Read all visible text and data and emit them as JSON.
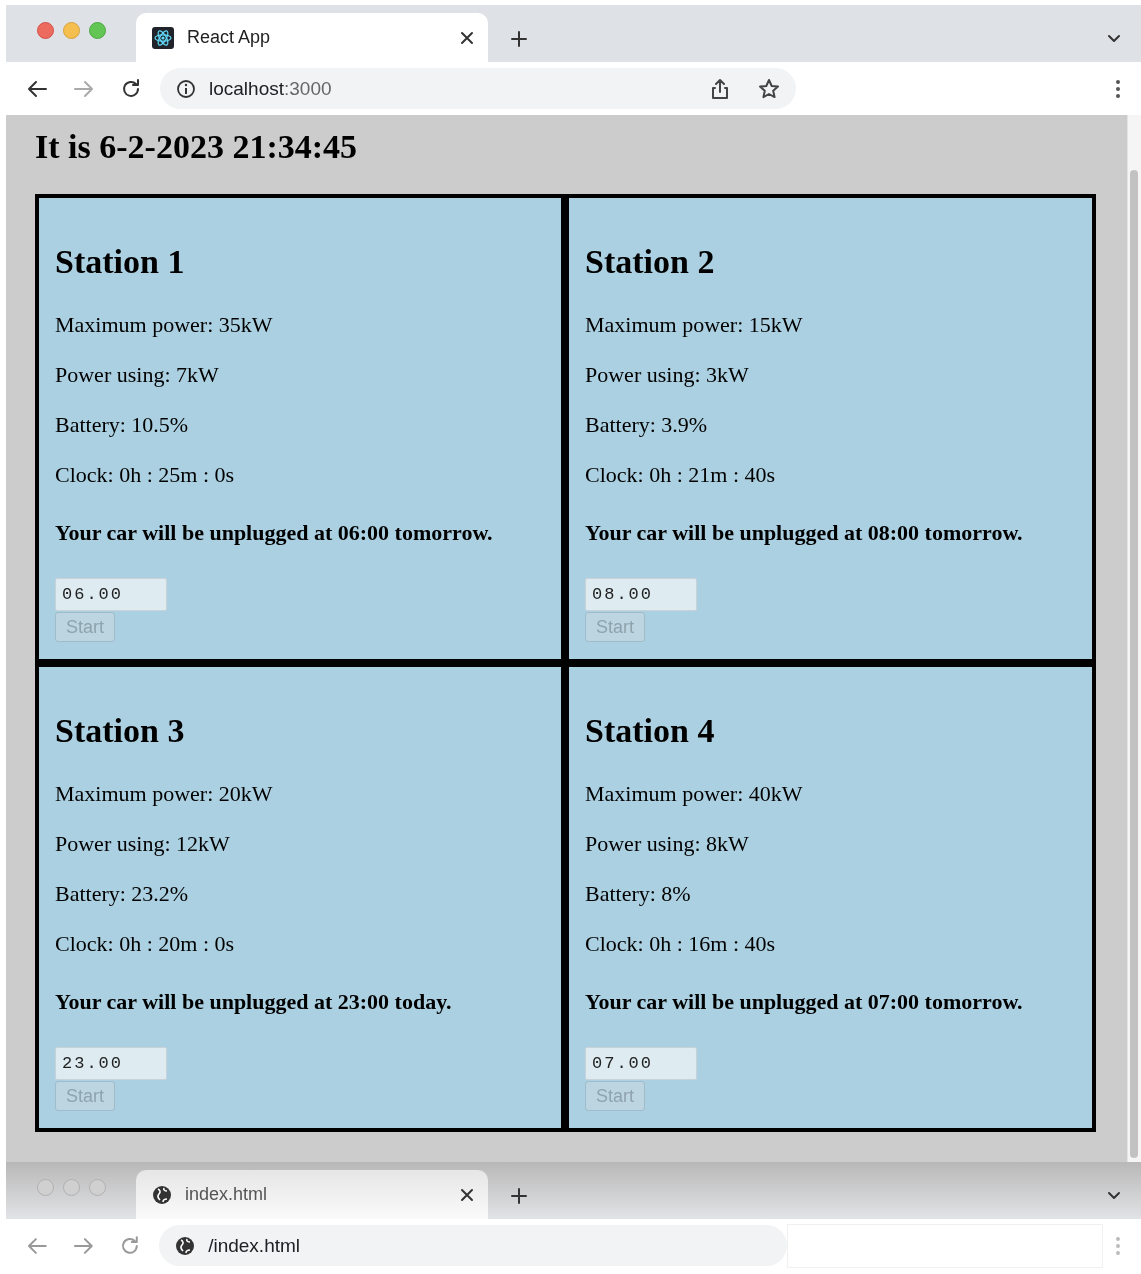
{
  "windows": [
    {
      "focused": true,
      "tab": {
        "title": "React App",
        "selected": true
      },
      "forward_disabled": true,
      "address": {
        "parts": [
          {
            "text": "localhost",
            "kind": "host"
          },
          {
            "text": ":3000",
            "kind": "port"
          }
        ]
      },
      "page": {
        "heading": "It is 6-2-2023 21:34:45",
        "stations": [
          {
            "title": "Station 1",
            "lines": [
              "Maximum power: 35kW",
              "Power using: 7kW",
              "Battery: 10.5%",
              "Clock: 0h : 25m : 0s"
            ],
            "notice": "Your car will be unplugged at 06:00 tomorrow.",
            "time_value": "06.00",
            "button": {
              "label": "Start",
              "disabled": true
            }
          },
          {
            "title": "Station 2",
            "lines": [
              "Maximum power: 15kW",
              "Power using: 3kW",
              "Battery: 3.9%",
              "Clock: 0h : 21m : 40s"
            ],
            "notice": "Your car will be unplugged at 08:00 tomorrow.",
            "time_value": "08.00",
            "button": {
              "label": "Start",
              "disabled": true
            }
          },
          {
            "title": "Station 3",
            "lines": [
              "Maximum power: 20kW",
              "Power using: 12kW",
              "Battery: 23.2%",
              "Clock: 0h : 20m : 0s"
            ],
            "notice": "Your car will be unplugged at 23:00 today.",
            "time_value": "23.00",
            "button": {
              "label": "Start",
              "disabled": true
            }
          },
          {
            "title": "Station 4",
            "lines": [
              "Maximum power: 40kW",
              "Power using: 8kW",
              "Battery: 8%",
              "Clock: 0h : 16m : 40s"
            ],
            "notice": "Your car will be unplugged at 07:00 tomorrow.",
            "time_value": "07.00",
            "button": {
              "label": "Start",
              "disabled": true
            }
          }
        ]
      }
    },
    {
      "focused": false,
      "tab": {
        "title": "index.html",
        "selected": true
      },
      "forward_disabled": false,
      "address": {
        "parts": [
          {
            "text": "/index.html",
            "kind": "path"
          }
        ]
      }
    }
  ]
}
